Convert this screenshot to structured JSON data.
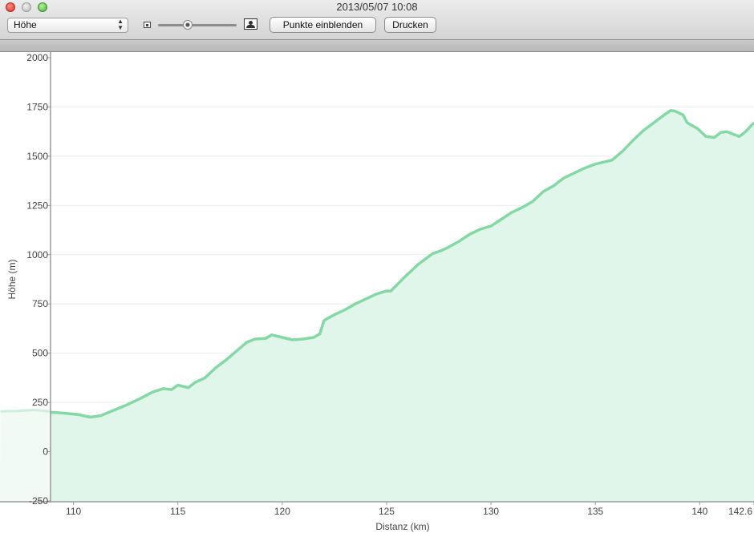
{
  "window": {
    "title": "2013/05/07 10:08"
  },
  "toolbar": {
    "select_value": "Höhe",
    "select_arrow_up": "▲",
    "select_arrow_down": "▼",
    "zoom_slider_value": 0.38,
    "show_points_label": "Punkte einblenden",
    "print_label": "Drucken"
  },
  "colors": {
    "line": "#84d8a4",
    "fill": "#e0f6ea",
    "fill_faded": "#f1faf5",
    "line_faded": "#cdeedd"
  },
  "chart_data": {
    "type": "area",
    "xlabel": "Distanz (km)",
    "ylabel": "Höhe (m)",
    "xlim": [
      108.9,
      142.6
    ],
    "ylim": [
      -250,
      2000
    ],
    "x_ticks": [
      110,
      115,
      120,
      125,
      130,
      135,
      140,
      142.6
    ],
    "x_tick_labels": [
      "110",
      "115",
      "120",
      "125",
      "130",
      "135",
      "140",
      "142.6"
    ],
    "y_ticks": [
      -250,
      0,
      250,
      500,
      750,
      1000,
      1250,
      1500,
      1750,
      2000
    ],
    "y_tick_labels": [
      "-250",
      "0",
      "250",
      "500",
      "750",
      "1000",
      "1250",
      "1500",
      "1750",
      "2000"
    ],
    "grid": true,
    "faded_segment": {
      "x": [
        106.5,
        107.3,
        108.1,
        108.9
      ],
      "y": [
        205,
        207,
        212,
        205
      ]
    },
    "series": [
      {
        "x": [
          108.9,
          109.5,
          110.2,
          110.8,
          111.3,
          111.8,
          112.5,
          113.2,
          113.8,
          114.3,
          114.7,
          115.0,
          115.5,
          115.8,
          116.3,
          116.8,
          117.3,
          117.8,
          118.3,
          118.7,
          119.2,
          119.5,
          120.0,
          120.5,
          121.0,
          121.5,
          121.8,
          122.0,
          122.1,
          122.5,
          123.0,
          123.5,
          124.0,
          124.5,
          125.0,
          125.2,
          125.8,
          126.5,
          127.2,
          127.6,
          128.0,
          128.5,
          129.0,
          129.5,
          130.0,
          130.5,
          131.0,
          131.5,
          132.0,
          132.5,
          133.0,
          133.5,
          134.0,
          134.5,
          135.0,
          135.3,
          135.8,
          136.3,
          136.8,
          137.3,
          137.8,
          138.3,
          138.6,
          138.8,
          139.2,
          139.4,
          139.9,
          140.3,
          140.7,
          141.0,
          141.3,
          141.6,
          141.9,
          142.2,
          142.6
        ],
        "y": [
          200,
          196,
          189,
          175,
          183,
          205,
          235,
          270,
          303,
          320,
          315,
          338,
          325,
          350,
          375,
          425,
          465,
          510,
          555,
          572,
          575,
          593,
          580,
          568,
          572,
          580,
          598,
          665,
          672,
          695,
          720,
          750,
          775,
          800,
          816,
          815,
          880,
          950,
          1005,
          1020,
          1040,
          1070,
          1105,
          1130,
          1145,
          1180,
          1215,
          1240,
          1270,
          1320,
          1350,
          1390,
          1415,
          1440,
          1460,
          1468,
          1480,
          1525,
          1580,
          1630,
          1670,
          1710,
          1732,
          1730,
          1710,
          1670,
          1640,
          1600,
          1595,
          1620,
          1625,
          1612,
          1600,
          1625,
          1670
        ]
      }
    ]
  }
}
